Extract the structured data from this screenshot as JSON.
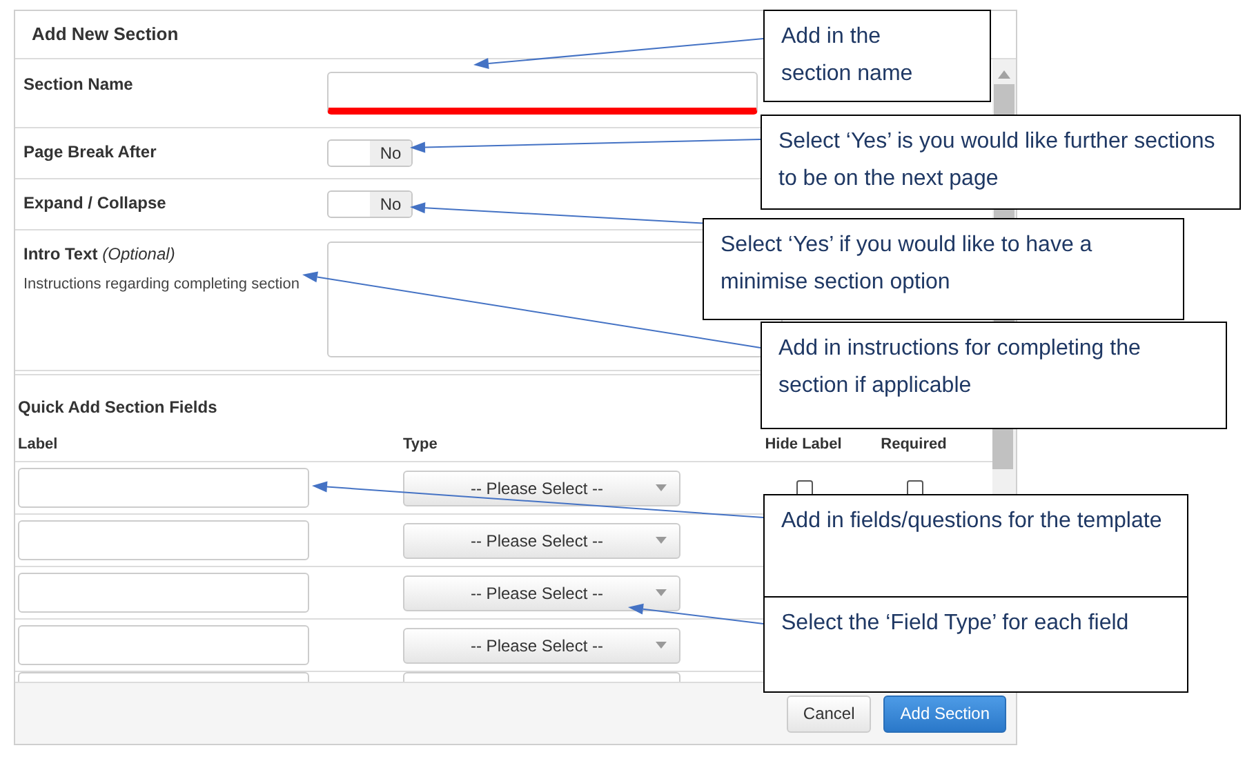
{
  "dialog": {
    "title": "Add New Section",
    "form": [
      {
        "kind": "text",
        "label": "Section Name",
        "invalid": true
      },
      {
        "kind": "toggle",
        "label": "Page Break After",
        "on": false,
        "value_text": "No"
      },
      {
        "kind": "toggle",
        "label": "Expand / Collapse",
        "on": false,
        "value_text": "No"
      },
      {
        "kind": "textarea",
        "label": "Intro Text",
        "label_note": "(Optional)",
        "help": "Instructions regarding completing section"
      }
    ],
    "quick_add": {
      "title": "Quick Add Section Fields",
      "columns": [
        "Label",
        "Type",
        "Hide Label",
        "Required"
      ],
      "rows": [
        {
          "type_placeholder": "-- Please Select --",
          "hide_label": false,
          "required": false
        },
        {
          "type_placeholder": "-- Please Select --"
        },
        {
          "type_placeholder": "-- Please Select --"
        },
        {
          "type_placeholder": "-- Please Select --"
        }
      ]
    },
    "buttons": [
      {
        "label": "Cancel",
        "kind": "secondary"
      },
      {
        "label": "Add Section",
        "kind": "primary"
      }
    ]
  },
  "callouts": [
    {
      "text": "Add in the section name"
    },
    {
      "text": "Select ‘Yes’ is you would like further sections to be on the next page"
    },
    {
      "text": "Select ‘Yes’ if you would like to have a minimise section option"
    },
    {
      "text": "Add in instructions for completing the section if applicable"
    },
    {
      "text": "Add in fields/questions for the template"
    },
    {
      "text": "Select the ‘Field Type’ for each field"
    }
  ]
}
